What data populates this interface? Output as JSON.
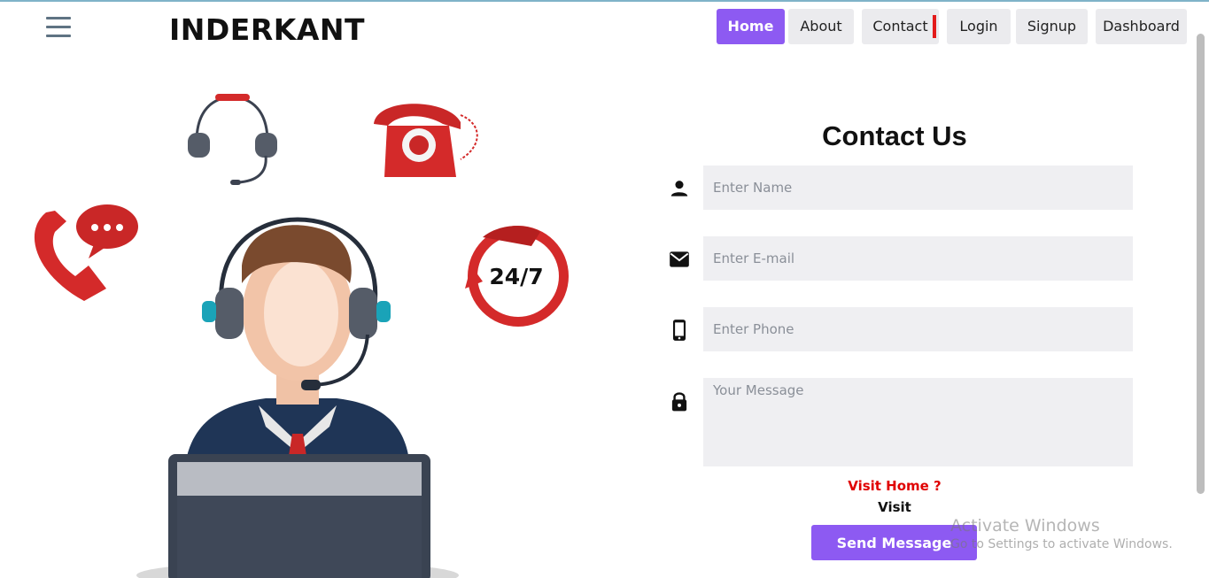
{
  "brand": "INDERKANT",
  "nav": {
    "items": [
      {
        "label": "Home"
      },
      {
        "label": "About"
      },
      {
        "label": "Contact"
      },
      {
        "label": "Login"
      },
      {
        "label": "Signup"
      },
      {
        "label": "Dashboard"
      }
    ],
    "active": "Home"
  },
  "illustration": {
    "clock_label": "24/7"
  },
  "contact": {
    "title": "Contact Us",
    "name_placeholder": "Enter Name",
    "email_placeholder": "Enter E-mail",
    "phone_placeholder": "Enter Phone",
    "message_placeholder": "Your Message",
    "visit_home": "Visit Home ?",
    "visit": "Visit",
    "send_label": "Send Message"
  },
  "icons": {
    "name": "person-icon",
    "email": "mail-icon",
    "phone": "mobile-icon",
    "message": "lock-icon"
  },
  "colors": {
    "accent": "#8d5af2",
    "link_red": "#e00000",
    "field_bg": "#efeff2",
    "illustration_red": "#d42a2a"
  },
  "watermark": {
    "line1": "Activate Windows",
    "line2": "Go to Settings to activate Windows."
  }
}
